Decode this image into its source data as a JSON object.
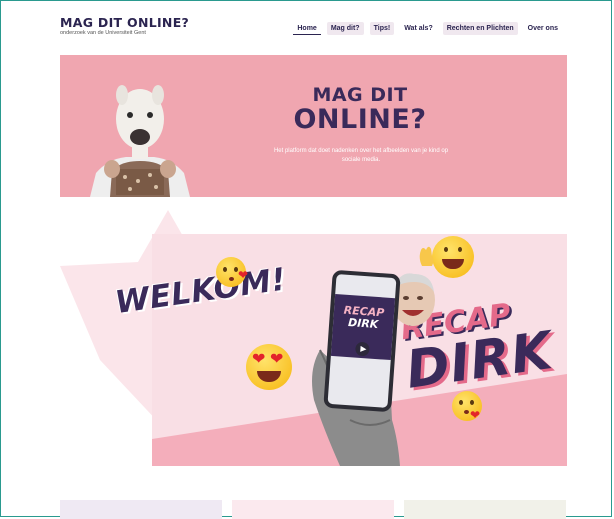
{
  "header": {
    "logo_title": "MAG DIT ONLINE?",
    "logo_subtitle": "onderzoek van de Universiteit Gent"
  },
  "nav": {
    "items": [
      {
        "label": "Home",
        "active": true
      },
      {
        "label": "Mag dit?"
      },
      {
        "label": "Tips!"
      },
      {
        "label": "Wat als?"
      },
      {
        "label": "Rechten en Plichten"
      },
      {
        "label": "Over ons"
      }
    ]
  },
  "hero": {
    "title_line1": "MAG DIT",
    "title_line2": "ONLINE?",
    "subtitle": "Het platform dat doet nadenken over het afbeelden van je kind op sociale media.",
    "background_color": "#f0a6b0"
  },
  "video": {
    "welcome_text": "WELKOM!",
    "recap_line1": "RECAP",
    "recap_line2": "DIRK",
    "phone_line1": "RECAP",
    "phone_line2": "DIRK",
    "play_icon": "play-icon"
  },
  "colors": {
    "brand_dark": "#3a2a5a",
    "brand_pink": "#f0a6b0",
    "accent_pink": "#e46a8a",
    "frame": "#2a9a8f"
  }
}
